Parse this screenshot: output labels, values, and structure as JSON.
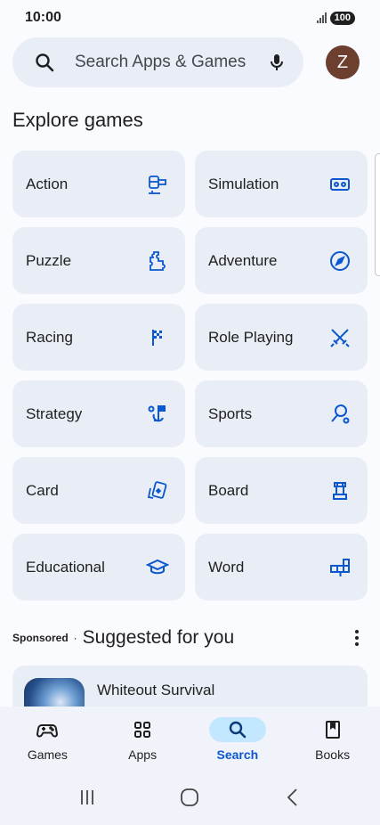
{
  "status_bar": {
    "time": "10:00",
    "battery": "100"
  },
  "search": {
    "placeholder": "Search Apps & Games",
    "icon": "search-icon",
    "mic_icon": "mic-icon"
  },
  "avatar": {
    "initial": "Z",
    "color": "#6d3f2f"
  },
  "explore": {
    "title": "Explore games",
    "tiles": [
      {
        "label": "Action",
        "icon": "helicopter-icon"
      },
      {
        "label": "Simulation",
        "icon": "vr-headset-icon"
      },
      {
        "label": "Puzzle",
        "icon": "puzzle-icon"
      },
      {
        "label": "Adventure",
        "icon": "compass-icon"
      },
      {
        "label": "Racing",
        "icon": "checkered-flag-icon"
      },
      {
        "label": "Role Playing",
        "icon": "crossed-swords-icon"
      },
      {
        "label": "Strategy",
        "icon": "strategy-flag-icon"
      },
      {
        "label": "Sports",
        "icon": "racket-icon"
      },
      {
        "label": "Card",
        "icon": "cards-icon"
      },
      {
        "label": "Board",
        "icon": "chess-rook-icon"
      },
      {
        "label": "Educational",
        "icon": "graduation-cap-icon"
      },
      {
        "label": "Word",
        "icon": "word-blocks-icon"
      }
    ]
  },
  "suggested": {
    "sponsored": "Sponsored",
    "separator": "·",
    "title": "Suggested for you",
    "app": {
      "name": "Whiteout Survival"
    }
  },
  "bottom_nav": {
    "items": [
      {
        "label": "Games",
        "icon": "gamepad-icon",
        "active": false
      },
      {
        "label": "Apps",
        "icon": "apps-grid-icon",
        "active": false
      },
      {
        "label": "Search",
        "icon": "search-icon",
        "active": true
      },
      {
        "label": "Books",
        "icon": "book-icon",
        "active": false
      }
    ]
  },
  "colors": {
    "accent": "#0b57d0",
    "tile_bg": "#e9eef6",
    "active_pill": "#c2e7ff"
  }
}
